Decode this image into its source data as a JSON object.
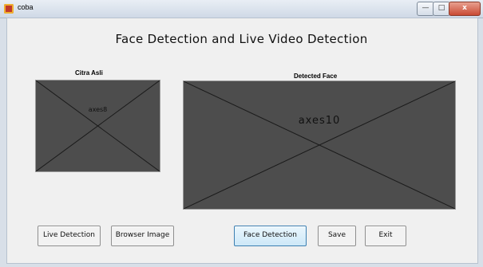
{
  "window": {
    "title": "coba",
    "min_glyph": "—",
    "max_glyph": "□",
    "close_glyph": "x"
  },
  "main": {
    "title": "Face Detection and Live Video Detection"
  },
  "axes_left": {
    "label": "Citra Asli",
    "name": "axes8"
  },
  "axes_right": {
    "label": "Detected Face",
    "name": "axes10"
  },
  "buttons": {
    "live_detection": "Live Detection",
    "browser_image": "Browser Image",
    "face_detection": "Face Detection",
    "save": "Save",
    "exit": "Exit"
  },
  "colors": {
    "axes_bg": "#4d4d4d",
    "focus_border": "#3c7fb1"
  }
}
